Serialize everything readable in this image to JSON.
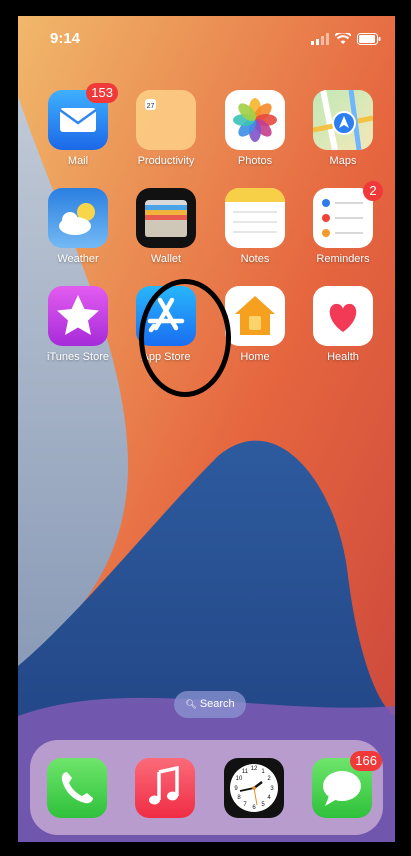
{
  "status_bar": {
    "time": "9:14"
  },
  "apps": [
    {
      "id": "mail",
      "label": "Mail",
      "badge": "153"
    },
    {
      "id": "productivity",
      "label": "Productivity",
      "badge": null
    },
    {
      "id": "photos",
      "label": "Photos",
      "badge": null
    },
    {
      "id": "maps",
      "label": "Maps",
      "badge": null
    },
    {
      "id": "weather",
      "label": "Weather",
      "badge": null
    },
    {
      "id": "wallet",
      "label": "Wallet",
      "badge": null
    },
    {
      "id": "notes",
      "label": "Notes",
      "badge": null
    },
    {
      "id": "reminders",
      "label": "Reminders",
      "badge": "2"
    },
    {
      "id": "itunes",
      "label": "iTunes Store",
      "badge": null
    },
    {
      "id": "appstore",
      "label": "App Store",
      "badge": null
    },
    {
      "id": "home",
      "label": "Home",
      "badge": null
    },
    {
      "id": "health",
      "label": "Health",
      "badge": null
    }
  ],
  "search": {
    "label": "Search"
  },
  "dock": [
    {
      "id": "phone",
      "badge": null
    },
    {
      "id": "music",
      "badge": null
    },
    {
      "id": "clock",
      "badge": null
    },
    {
      "id": "messages",
      "badge": "166"
    }
  ],
  "colors": {
    "badge": "#f03a3a",
    "annotation": "#000000"
  }
}
